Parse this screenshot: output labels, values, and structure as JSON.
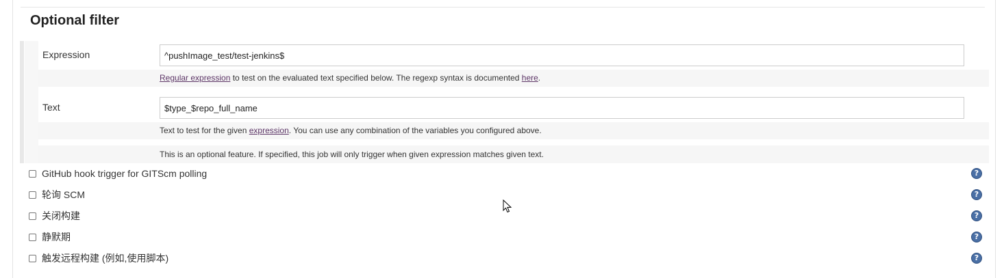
{
  "section": {
    "title": "Optional filter"
  },
  "expression": {
    "label": "Expression",
    "value": "^pushImage_test/test-jenkins$",
    "help_link1": "Regular expression",
    "help_mid": " to test on the evaluated text specified below. The regexp syntax is documented ",
    "help_link2": "here",
    "help_end": "."
  },
  "text": {
    "label": "Text",
    "value": "$type_$repo_full_name",
    "help_start": "Text to test for the given ",
    "help_link": "expression",
    "help_end": ". You can use any combination of the variables you configured above."
  },
  "optional_note": "This is an optional feature. If specified, this job will only trigger when given expression matches given text.",
  "triggers": [
    {
      "label": "GitHub hook trigger for GITScm polling",
      "checked": false
    },
    {
      "label": "轮询 SCM",
      "checked": false
    },
    {
      "label": "关闭构建",
      "checked": false
    },
    {
      "label": "静默期",
      "checked": false
    },
    {
      "label": "触发远程构建 (例如,使用脚本)",
      "checked": false
    }
  ],
  "icons": {
    "help": "help-icon",
    "cursor": "mouse-pointer-icon"
  },
  "colors": {
    "help_icon": "#4a6fa5",
    "link": "#5c3566",
    "band": "#f6f6f6"
  }
}
